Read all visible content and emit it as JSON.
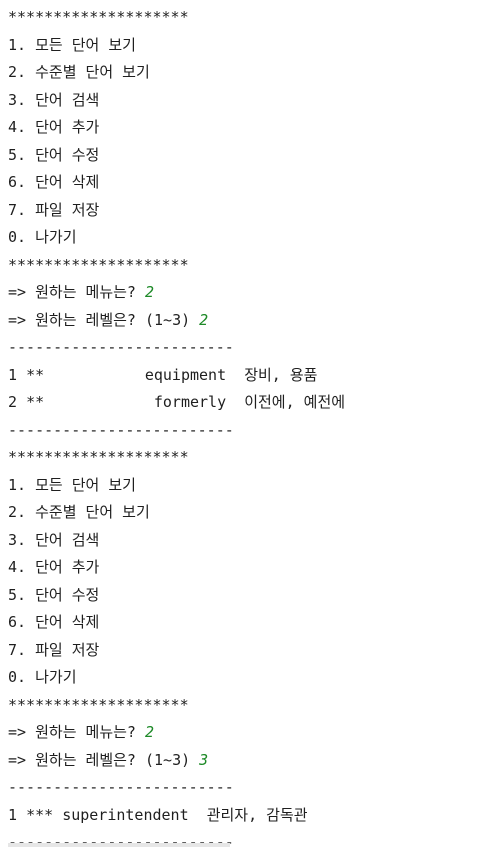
{
  "console": {
    "separator_star": "********************",
    "separator_dash": "-------------------------",
    "menu": [
      "1. 모든 단어 보기",
      "2. 수준별 단어 보기",
      "3. 단어 검색",
      "4. 단어 추가",
      "5. 단어 수정",
      "6. 단어 삭제",
      "7. 파일 저장",
      "0. 나가기"
    ],
    "prompt_menu": "=> 원하는 메뉴는? ",
    "prompt_level": "=> 원하는 레벨은? (1~3) ",
    "session1": {
      "menu_input": "2",
      "level_input": "2",
      "rows": [
        {
          "num": "1",
          "stars": "**",
          "word": "equipment",
          "meaning": "장비, 용품"
        },
        {
          "num": "2",
          "stars": "**",
          "word": "formerly",
          "meaning": "이전에, 예전에"
        }
      ]
    },
    "session2": {
      "menu_input": "2",
      "level_input": "3",
      "rows": [
        {
          "num": "1",
          "stars": "***",
          "word": "superintendent",
          "meaning": "관리자, 감독관"
        }
      ]
    }
  }
}
